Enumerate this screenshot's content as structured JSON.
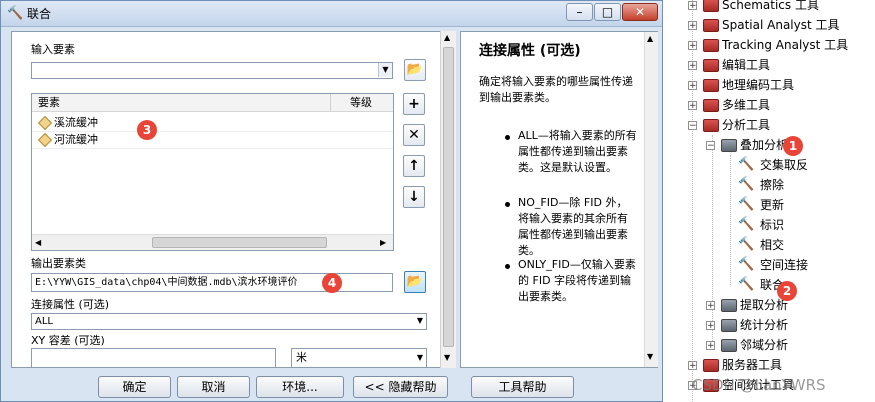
{
  "dialog": {
    "title": "联合",
    "title_icon": "hammer-icon",
    "window_buttons": [
      "–",
      "□",
      "✕"
    ],
    "input_features": {
      "label": "输入要素",
      "value": "",
      "columns": [
        "要素",
        "等级"
      ],
      "rows": [
        "溪流缓冲",
        "河流缓冲"
      ]
    },
    "output": {
      "label": "输出要素类",
      "value": "E:\\YYW\\GIS_data\\chp04\\中间数据.mdb\\滨水环境评价"
    },
    "join_attributes": {
      "label": "连接属性 (可选)",
      "value": "ALL"
    },
    "xy_tolerance": {
      "label": "XY 容差 (可选)",
      "value": "",
      "unit": "米"
    },
    "side_buttons": [
      "+",
      "✕",
      "↑",
      "↓"
    ],
    "buttons": {
      "ok": "确定",
      "cancel": "取消",
      "environments": "环境...",
      "hide_help": "<< 隐藏帮助",
      "tool_help": "工具帮助"
    },
    "help": {
      "title": "连接属性 (可选)",
      "intro": "确定将输入要素的哪些属性传递到输出要素类。",
      "bullets": [
        "ALL—将输入要素的所有属性都传递到输出要素类。这是默认设置。",
        "NO_FID—除 FID 外，将输入要素的其余所有属性都传递到输出要素类。",
        "ONLY_FID—仅输入要素的 FID 字段将传递到输出要素类。"
      ]
    }
  },
  "badges": [
    "1",
    "2",
    "3",
    "4"
  ],
  "tree": {
    "items": [
      {
        "label": "Schematics 工具",
        "expander": "+"
      },
      {
        "label": "Spatial Analyst 工具",
        "expander": "+"
      },
      {
        "label": "Tracking Analyst 工具",
        "expander": "+"
      },
      {
        "label": "编辑工具",
        "expander": "+"
      },
      {
        "label": "地理编码工具",
        "expander": "+"
      },
      {
        "label": "多维工具",
        "expander": "+"
      },
      {
        "label": "分析工具",
        "expander": "−"
      },
      {
        "label": "叠加分析",
        "expander": "−"
      },
      {
        "label": "交集取反"
      },
      {
        "label": "擦除"
      },
      {
        "label": "更新"
      },
      {
        "label": "标识"
      },
      {
        "label": "相交"
      },
      {
        "label": "空间连接"
      },
      {
        "label": "联合"
      },
      {
        "label": "提取分析",
        "expander": "+"
      },
      {
        "label": "统计分析",
        "expander": "+"
      },
      {
        "label": "邻域分析",
        "expander": "+"
      },
      {
        "label": "服务器工具",
        "expander": "+"
      },
      {
        "label": "空间统计工具",
        "expander": "+"
      }
    ]
  },
  "watermark": "CSDN @LanYWRS",
  "colors": {
    "badge": "#e84538",
    "toolbox": "#c0392b"
  }
}
